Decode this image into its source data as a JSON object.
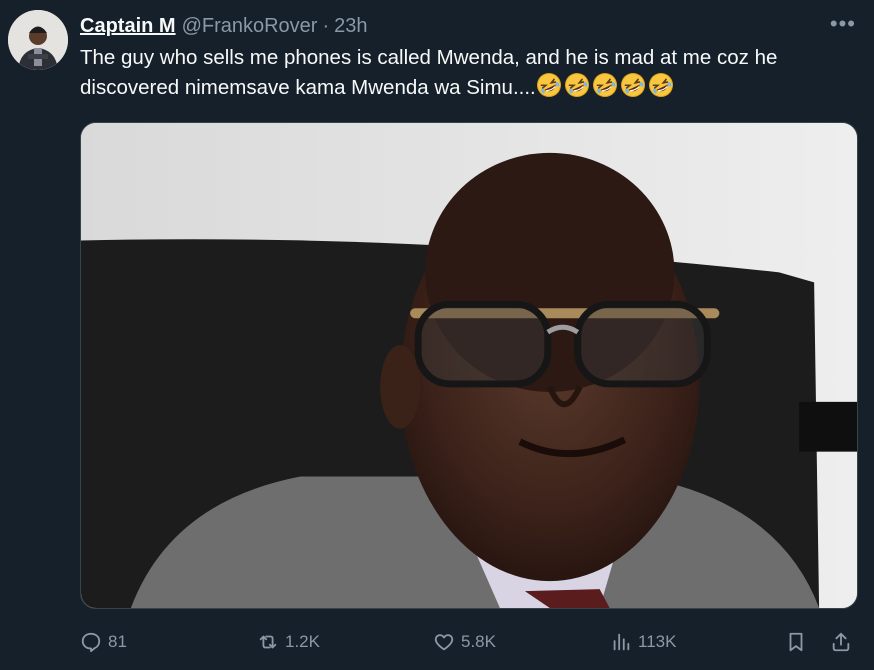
{
  "tweet": {
    "author_name": "Captain M",
    "handle": "@FrankoRover",
    "separator": "·",
    "time": "23h",
    "more_label": "•••",
    "text": "The guy who sells me phones is called Mwenda, and he is mad at me coz he discovered nimemsave kama Mwenda wa Simu....",
    "emoji_icon": "rolling-on-floor-laughing-emoji",
    "emoji_count": 5
  },
  "actions": {
    "replies": "81",
    "reposts": "1.2K",
    "likes": "5.8K",
    "views": "113K"
  },
  "colors": {
    "background": "#15202b",
    "text_primary": "#f7f9f9",
    "text_secondary": "#8b98a5",
    "border": "#38444d"
  }
}
